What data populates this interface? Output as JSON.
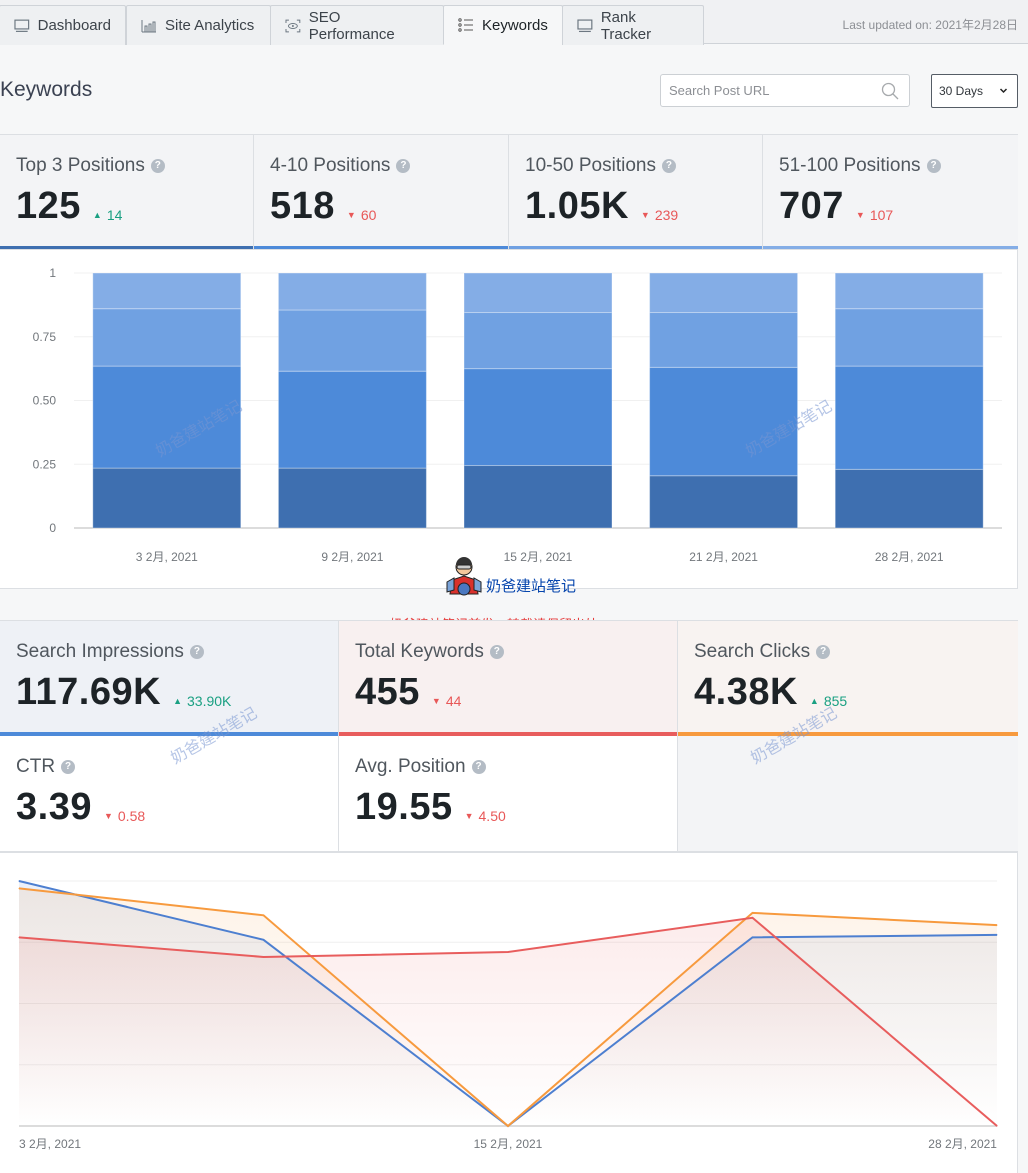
{
  "tabs": [
    {
      "label": "Dashboard",
      "icon": "monitor-icon",
      "active": false
    },
    {
      "label": "Site Analytics",
      "icon": "bar-chart-icon",
      "active": false
    },
    {
      "label": "SEO Performance",
      "icon": "eye-scan-icon",
      "active": false
    },
    {
      "label": "Keywords",
      "icon": "list-icon",
      "active": true
    },
    {
      "label": "Rank Tracker",
      "icon": "monitor-icon",
      "active": false
    }
  ],
  "last_updated": "Last updated on: 2021年2月28日",
  "header": {
    "title": "Keywords",
    "search_placeholder": "Search Post URL",
    "range_value": "30 Days"
  },
  "position_stats": [
    {
      "label": "Top 3 Positions",
      "value": "125",
      "delta": "14",
      "direction": "up",
      "color": "#3e6fb0"
    },
    {
      "label": "4-10 Positions",
      "value": "518",
      "delta": "60",
      "direction": "down",
      "color": "#4d8ad9"
    },
    {
      "label": "10-50 Positions",
      "value": "1.05K",
      "delta": "239",
      "direction": "down",
      "color": "#6fa0e2"
    },
    {
      "label": "51-100 Positions",
      "value": "707",
      "delta": "107",
      "direction": "down",
      "color": "#84ade6"
    }
  ],
  "traffic_stats": [
    {
      "label": "Search Impressions",
      "value": "117.69K",
      "delta": "33.90K",
      "direction": "up",
      "color": "#4d8ad9"
    },
    {
      "label": "Total Keywords",
      "value": "455",
      "delta": "44",
      "direction": "down",
      "color": "#e85d5d"
    },
    {
      "label": "Search Clicks",
      "value": "4.38K",
      "delta": "855",
      "direction": "up",
      "color": "#f79a3e"
    }
  ],
  "quality_stats": [
    {
      "label": "CTR",
      "value": "3.39",
      "delta": "0.58",
      "direction": "down"
    },
    {
      "label": "Avg. Position",
      "value": "19.55",
      "delta": "4.50",
      "direction": "down"
    }
  ],
  "watermark": {
    "text": "奶爸建站笔记",
    "notice": "奶爸建站笔记首发，转载请保留出处。"
  },
  "chart_data": [
    {
      "type": "bar",
      "stacked": true,
      "title": "",
      "categories": [
        "3 2月, 2021",
        "9 2月, 2021",
        "15 2月, 2021",
        "21 2月, 2021",
        "28 2月, 2021"
      ],
      "ylim": [
        0,
        1
      ],
      "yticks": [
        "0",
        "0.25",
        "0.50",
        "0.75",
        "1"
      ],
      "grid": true,
      "series": [
        {
          "name": "Top 3 Positions",
          "color": "#3e6fb0",
          "values": [
            0.235,
            0.235,
            0.245,
            0.205,
            0.23
          ]
        },
        {
          "name": "4-10 Positions",
          "color": "#4d8ad9",
          "values": [
            0.4,
            0.38,
            0.38,
            0.425,
            0.405
          ]
        },
        {
          "name": "10-50 Positions",
          "color": "#70a1e2",
          "values": [
            0.225,
            0.24,
            0.22,
            0.215,
            0.225
          ]
        },
        {
          "name": "51-100 Positions",
          "color": "#84ade6",
          "values": [
            0.14,
            0.145,
            0.155,
            0.155,
            0.14
          ]
        }
      ]
    },
    {
      "type": "area",
      "title": "",
      "x": [
        "3 2月, 2021",
        "9 2月, 2021",
        "15 2月, 2021",
        "21 2月, 2021",
        "28 2月, 2021"
      ],
      "xticks": [
        "3 2月, 2021",
        "15 2月, 2021",
        "28 2月, 2021"
      ],
      "ylim": [
        0,
        1
      ],
      "normalized": true,
      "grid": true,
      "series": [
        {
          "name": "Search Impressions",
          "color": "#4d7fd0",
          "values": [
            1.0,
            0.76,
            0.0,
            0.77,
            0.78
          ]
        },
        {
          "name": "Search Clicks",
          "color": "#f79a3e",
          "values": [
            0.97,
            0.86,
            0.0,
            0.87,
            0.82
          ]
        },
        {
          "name": "Total Keywords",
          "color": "#e85d5d",
          "values": [
            0.77,
            0.69,
            0.71,
            0.85,
            0.0
          ]
        }
      ]
    }
  ]
}
